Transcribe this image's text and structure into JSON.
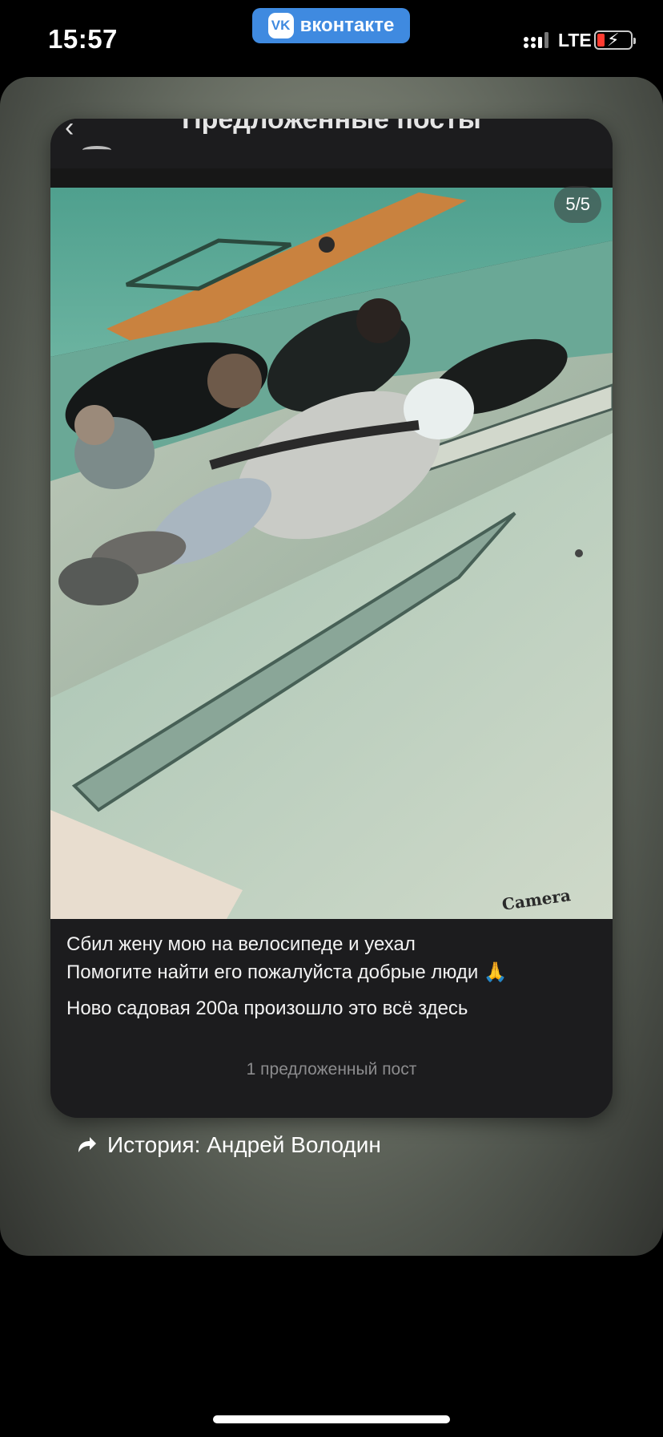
{
  "status_bar": {
    "time": "15:57",
    "app_banner": "вконтакте",
    "app_logo": "VK",
    "network": "LTE",
    "battery_state": "low-charging"
  },
  "card": {
    "header_title": "Предложенные посты",
    "photo_counter": "5/5",
    "watermark": "Camera",
    "post_lines": [
      "Сбил жену мою на велосипеде и уехал",
      "Помогите найти его пожалуйста добрые люди 🙏",
      "Ново садовая 200а произошло это всё здесь"
    ],
    "suggested_count_label": "1 предложенный пост"
  },
  "history": {
    "label": "История: Андрей Володин"
  },
  "colors": {
    "vk_blue": "#3f8ae0",
    "card_bg": "#1c1c1e"
  }
}
